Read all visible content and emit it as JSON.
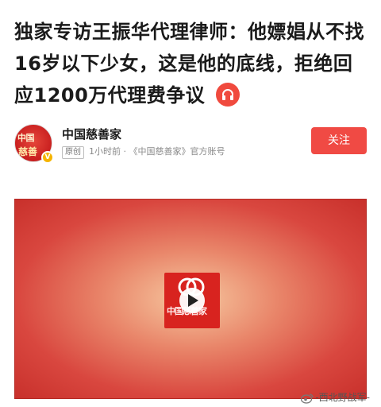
{
  "article": {
    "headline": "独家专访王振华代理律师：他嫖娼从不找16岁以下少女，这是他的底线，拒绝回应1200万代理费争议",
    "audio_icon": "headphones-icon"
  },
  "author": {
    "name": "中国慈善家",
    "badge": "原创",
    "meta": "1小时前 · 《中国慈善家》官方账号",
    "avatar_line1": "中国",
    "avatar_line2": "慈善",
    "follow_label": "关注"
  },
  "video": {
    "logo_text": "中国慈善家",
    "play_icon": "play-icon"
  },
  "watermark": {
    "text": "-西北野战军-",
    "icon": "weibo-icon"
  },
  "colors": {
    "accent": "#f04a44",
    "video_center": "#f6c8a0",
    "video_edge": "#c8302b"
  }
}
